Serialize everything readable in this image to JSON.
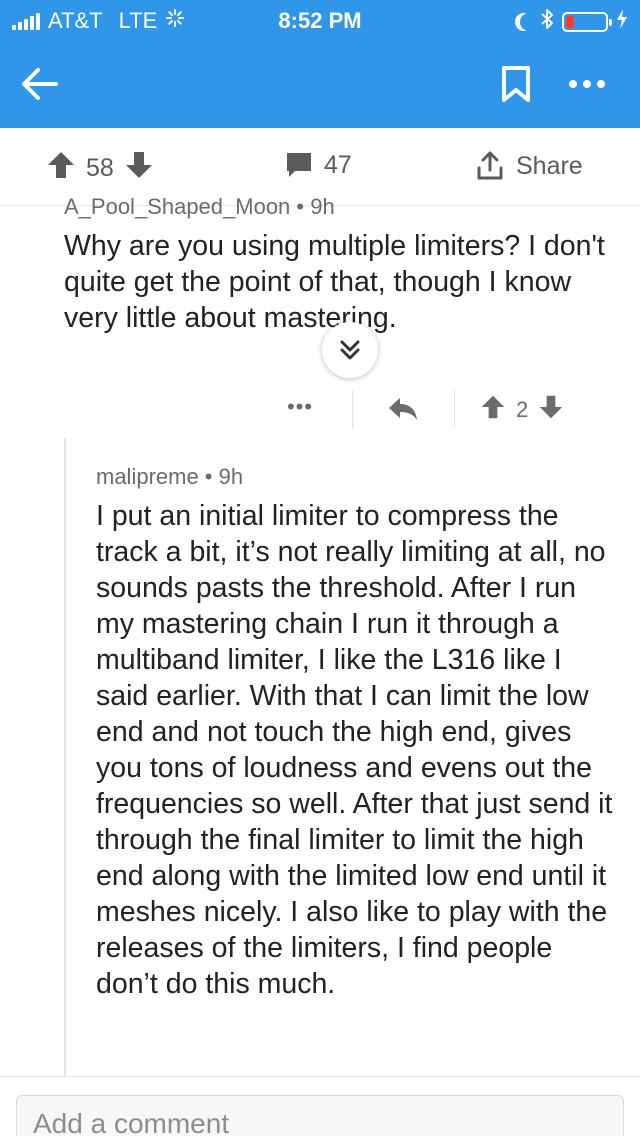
{
  "status_bar": {
    "carrier": "AT&T",
    "network": "LTE",
    "time": "8:52 PM"
  },
  "post_actions": {
    "upvotes": "58",
    "comments": "47",
    "share_label": "Share"
  },
  "comments": [
    {
      "author_meta": "A_Pool_Shaped_Moon • 9h",
      "body": "Why are you using multiple limiters? I don't quite get the point of that, though I know very little about mastering.",
      "more_label": "•••",
      "votes": "2"
    },
    {
      "author_meta": "malipreme • 9h",
      "body": "I put an initial limiter to compress the track a bit, it’s not really limiting at all, no sounds pasts the threshold. After I run my mastering chain I run it through a multiband limiter, I like the L316 like I said earlier. With that I can limit the low end and not touch the high end, gives you tons of loudness and evens out the frequencies so well. After that just send it through the final limiter to limit the high end along with the limited low end until it meshes nicely. I also like to play with the releases of the limiters, I find people don’t do this much."
    }
  ],
  "comment_input": {
    "placeholder": "Add a comment"
  },
  "colors": {
    "header": "#2f96e9",
    "battery_low": "#ff3b30"
  }
}
